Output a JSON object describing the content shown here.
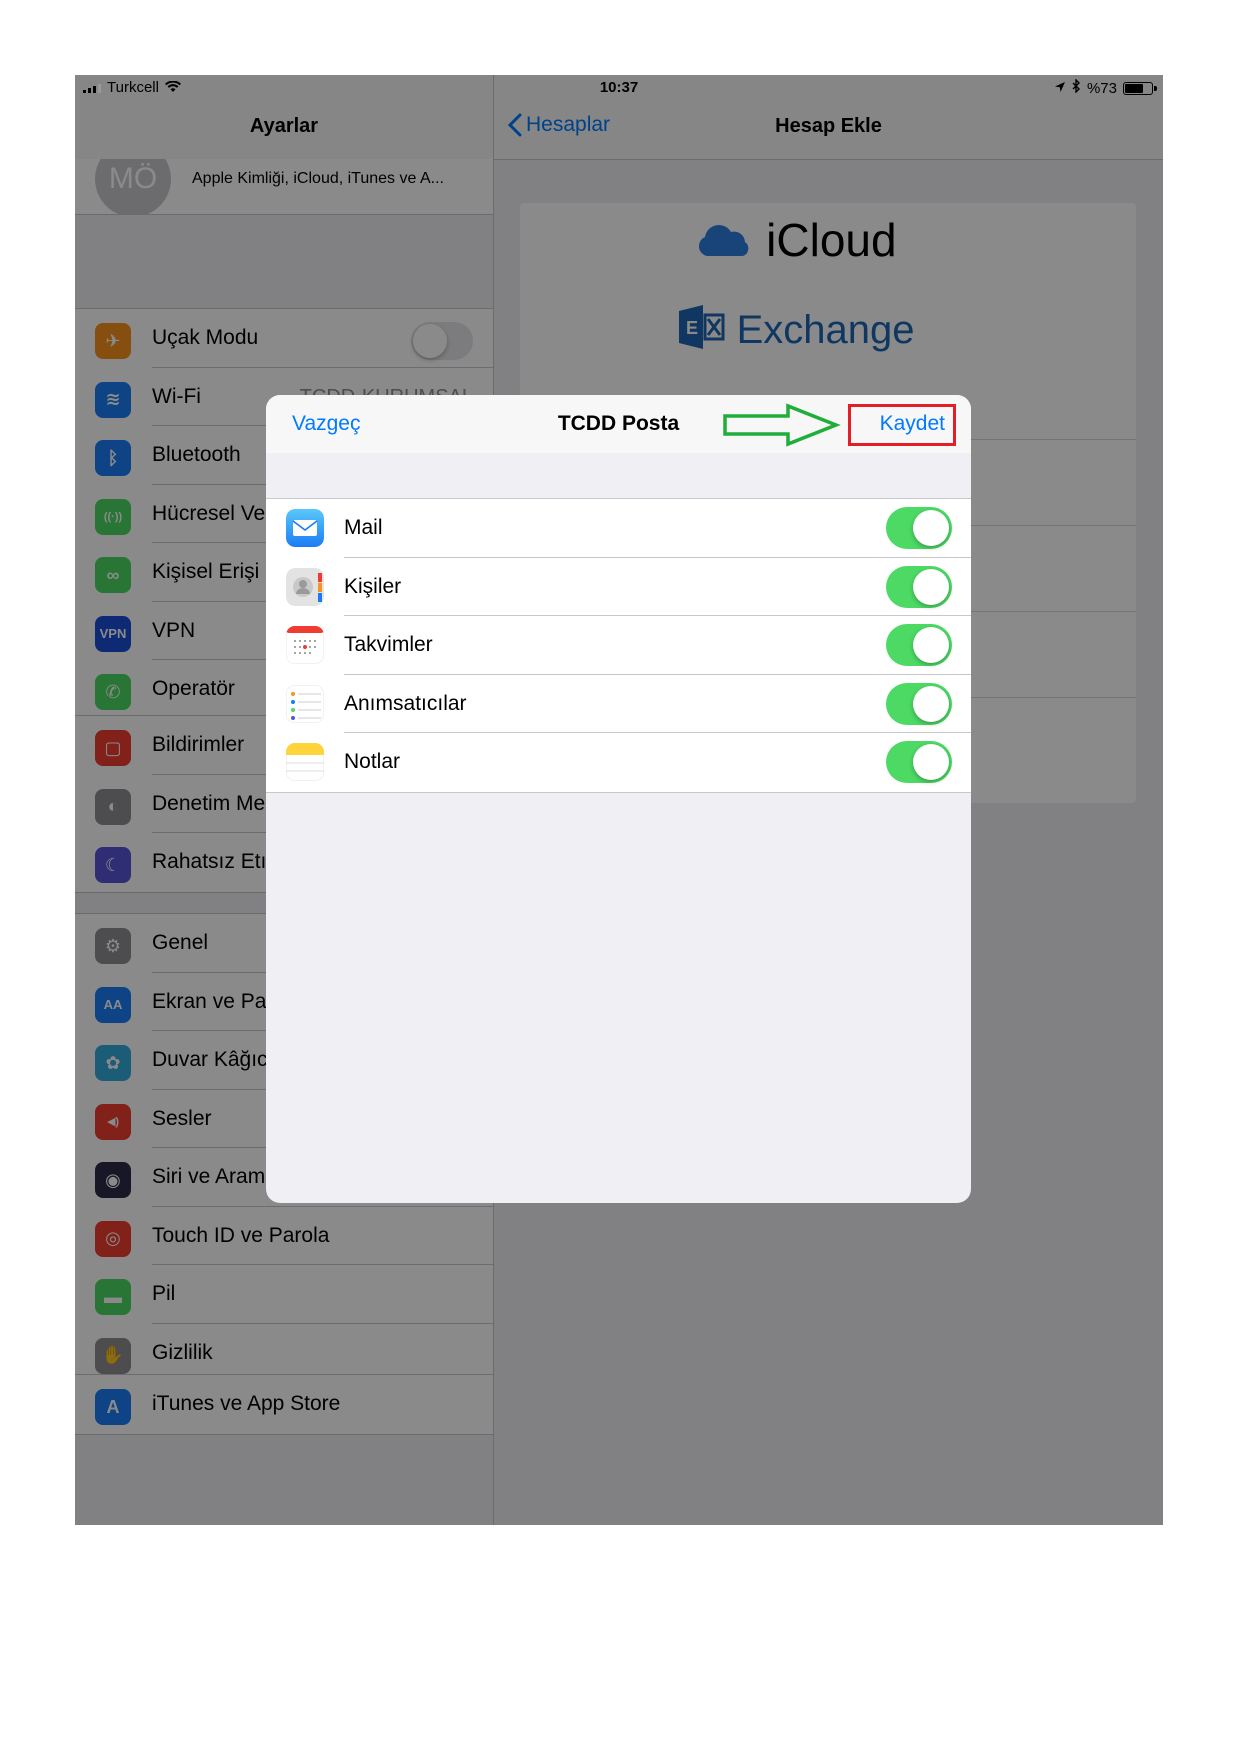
{
  "status_bar": {
    "carrier": "Turkcell",
    "time": "10:37",
    "battery_text": "%73",
    "battery_level": 0.73
  },
  "master": {
    "title": "Ayarlar",
    "profile_initials": "MÖ",
    "profile_subtitle": "Apple Kimliği, iCloud, iTunes ve A...",
    "groups": [
      {
        "items": [
          {
            "label": "Uçak Modu",
            "icon": "airplane-icon",
            "color": "#f7931e",
            "toggle_on": false
          },
          {
            "label": "Wi-Fi",
            "icon": "wifi-icon",
            "color": "#1a7cf5",
            "value": "TCDD-KURUMSAL"
          },
          {
            "label": "Bluetooth",
            "icon": "bluetooth-icon",
            "color": "#1a7cf5"
          },
          {
            "label": "Hücresel Ve",
            "icon": "cellular-icon",
            "color": "#4cd964"
          },
          {
            "label": "Kişisel Erişi",
            "icon": "hotspot-icon",
            "color": "#4cd964"
          },
          {
            "label": "VPN",
            "icon": "vpn-icon",
            "color": "#1a4ed8"
          },
          {
            "label": "Operatör",
            "icon": "phone-icon",
            "color": "#4cd964"
          }
        ]
      },
      {
        "items": [
          {
            "label": "Bildirimler",
            "icon": "notifications-icon",
            "color": "#f03b30"
          },
          {
            "label": "Denetim Me",
            "icon": "control-center-icon",
            "color": "#8e8e93"
          },
          {
            "label": "Rahatsız Etı",
            "icon": "moon-icon",
            "color": "#5856d6"
          }
        ]
      },
      {
        "items": [
          {
            "label": "Genel",
            "icon": "gear-icon",
            "color": "#8e8e93"
          },
          {
            "label": "Ekran ve Pa",
            "icon": "display-icon",
            "color": "#1a7cf5"
          },
          {
            "label": "Duvar Kâğıc",
            "icon": "wallpaper-icon",
            "color": "#33aadc"
          },
          {
            "label": "Sesler",
            "icon": "speaker-icon",
            "color": "#f03b30"
          },
          {
            "label": "Siri ve Arama",
            "icon": "siri-icon",
            "color": "#2b2b4a"
          },
          {
            "label": "Touch ID ve Parola",
            "icon": "fingerprint-icon",
            "color": "#f03b30"
          },
          {
            "label": "Pil",
            "icon": "battery-icon",
            "color": "#4cd964"
          },
          {
            "label": "Gizlilik",
            "icon": "hand-icon",
            "color": "#8e8e93"
          }
        ]
      },
      {
        "items": [
          {
            "label": "iTunes ve App Store",
            "icon": "app-store-icon",
            "color": "#1a7cf5"
          }
        ]
      }
    ]
  },
  "detail": {
    "back_label": "Hesaplar",
    "title": "Hesap Ekle",
    "providers": [
      "iCloud",
      "Exchange"
    ]
  },
  "modal": {
    "cancel": "Vazgeç",
    "title": "TCDD Posta",
    "save": "Kaydet",
    "items": [
      {
        "label": "Mail",
        "icon": "mail-icon",
        "on": true
      },
      {
        "label": "Kişiler",
        "icon": "contacts-icon",
        "on": true
      },
      {
        "label": "Takvimler",
        "icon": "calendar-icon",
        "on": true
      },
      {
        "label": "Anımsatıcılar",
        "icon": "reminders-icon",
        "on": true
      },
      {
        "label": "Notlar",
        "icon": "notes-icon",
        "on": true
      }
    ]
  },
  "colors": {
    "accent": "#007aff",
    "toggle_on": "#4cd964",
    "annotation_red": "#e41e26",
    "annotation_green": "#1fae3a"
  }
}
